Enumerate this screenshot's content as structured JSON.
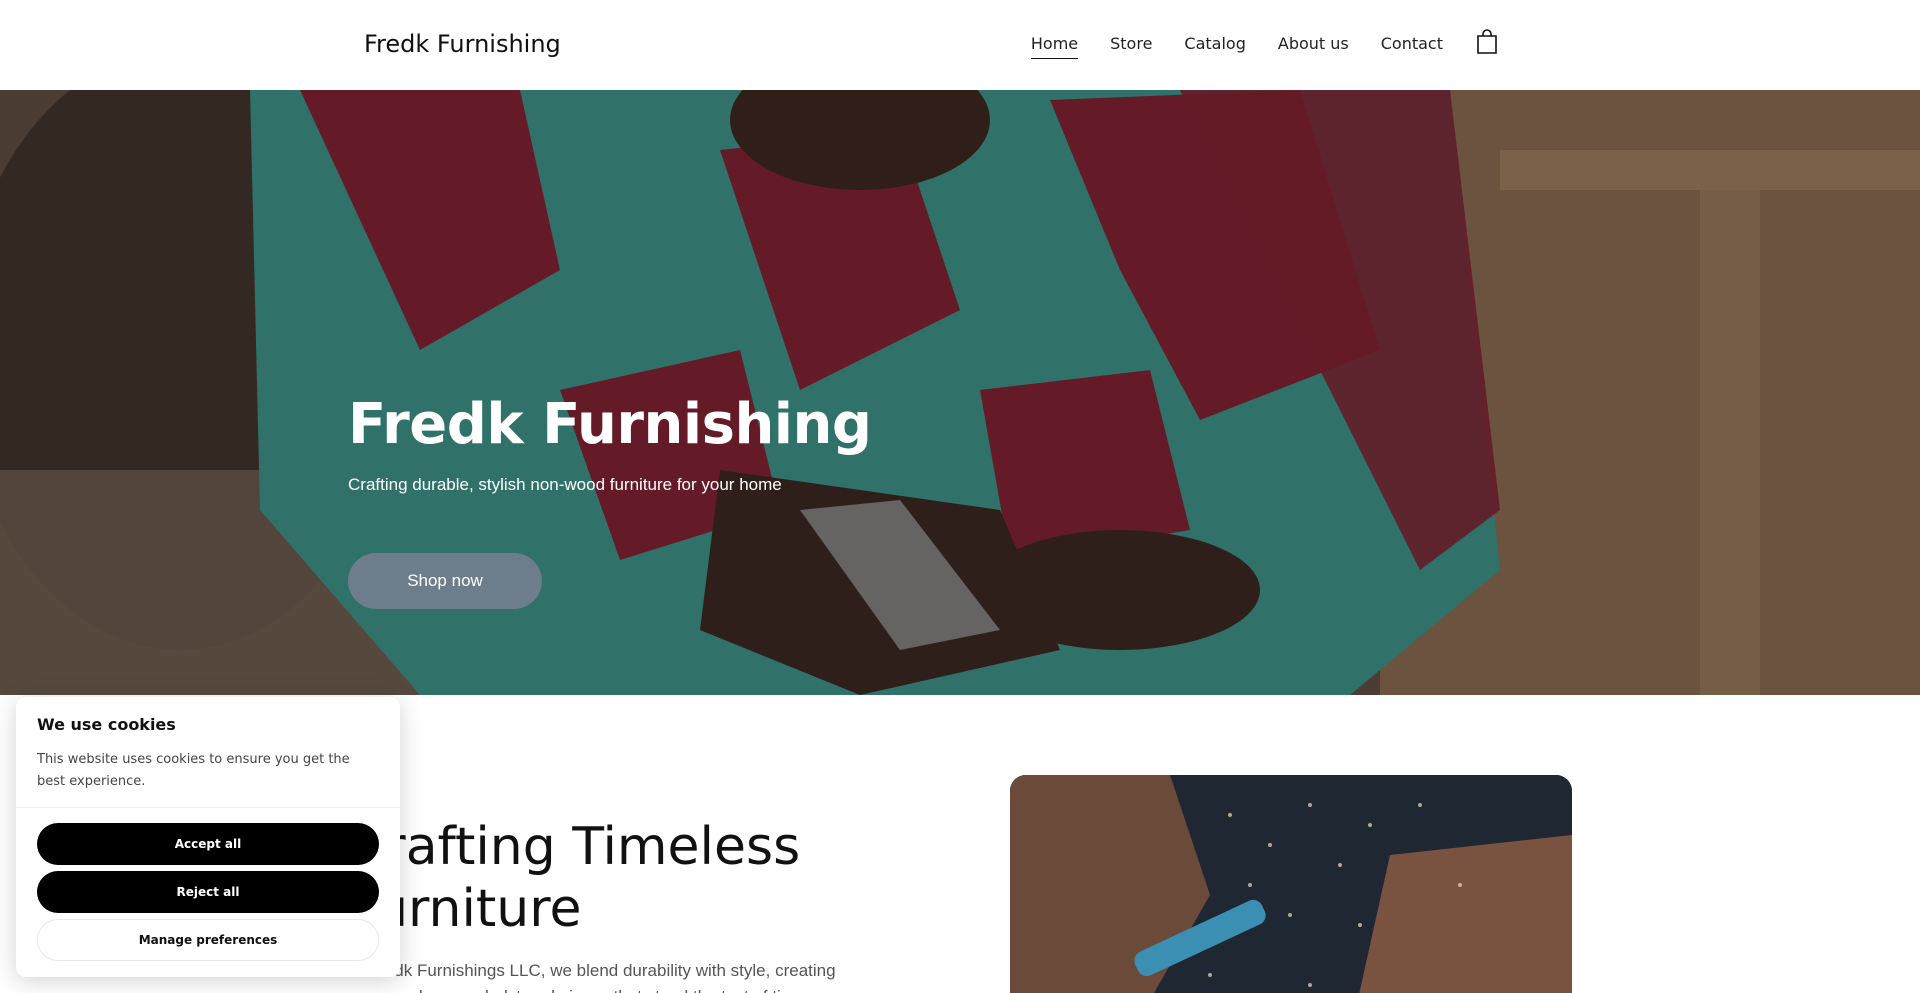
{
  "header": {
    "brand": "Fredk Furnishing",
    "nav": [
      {
        "label": "Home",
        "active": true
      },
      {
        "label": "Store",
        "active": false
      },
      {
        "label": "Catalog",
        "active": false
      },
      {
        "label": "About us",
        "active": false
      },
      {
        "label": "Contact",
        "active": false
      }
    ],
    "cart_icon": "shopping-bag-icon"
  },
  "hero": {
    "title": "Fredk Furnishing",
    "subtitle": "Crafting durable, stylish non-wood furniture for your home",
    "cta_label": "Shop now"
  },
  "section": {
    "title": "Crafting Timeless Furniture",
    "text": "At Fredk Furnishings LLC, we blend durability with style, creating non-wood, non-upholstered pieces that stand the test of time."
  },
  "cookie": {
    "title": "We use cookies",
    "text": "This website uses cookies to ensure you get the best experience.",
    "accept_label": "Accept all",
    "reject_label": "Reject all",
    "manage_label": "Manage preferences"
  },
  "colors": {
    "cta": "#6e7d8c",
    "cookie_button": "#000000"
  }
}
